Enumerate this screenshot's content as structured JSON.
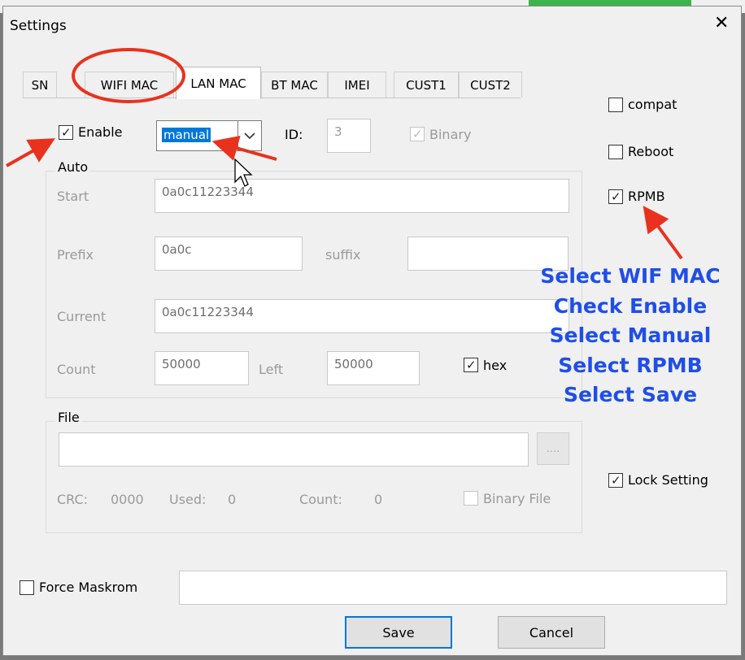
{
  "window": {
    "title": "Settings",
    "close_glyph": "✕"
  },
  "tabs": [
    {
      "label": "SN",
      "active": false
    },
    {
      "label": "WIFI MAC",
      "active": false
    },
    {
      "label": "LAN MAC",
      "active": true
    },
    {
      "label": "BT MAC",
      "active": false
    },
    {
      "label": "IMEI",
      "active": false
    },
    {
      "label": "CUST1",
      "active": false
    },
    {
      "label": "CUST2",
      "active": false
    }
  ],
  "enable": {
    "label": "Enable",
    "checked": true
  },
  "mode_combo": {
    "value": "manual"
  },
  "id": {
    "label": "ID:",
    "value": "3"
  },
  "binary": {
    "label": "Binary",
    "checked": true,
    "disabled": true
  },
  "auto": {
    "title": "Auto",
    "start_label": "Start",
    "start_value": "0a0c11223344",
    "prefix_label": "Prefix",
    "prefix_value": "0a0c",
    "suffix_label": "suffix",
    "suffix_value": "",
    "current_label": "Current",
    "current_value": "0a0c11223344",
    "count_label": "Count",
    "count_value": "50000",
    "left_label": "Left",
    "left_value": "50000",
    "hex_label": "hex",
    "hex_checked": true
  },
  "file": {
    "title": "File",
    "path_value": "",
    "browse_label": "....",
    "crc_label": "CRC:",
    "crc_value": "0000",
    "used_label": "Used:",
    "used_value": "0",
    "count_label": "Count:",
    "count_value": "0",
    "binary_file_label": "Binary File",
    "binary_file_checked": false
  },
  "right_options": {
    "compat": {
      "label": "compat",
      "checked": false
    },
    "reboot": {
      "label": "Reboot",
      "checked": false
    },
    "rpmb": {
      "label": "RPMB",
      "checked": true
    },
    "lock_setting": {
      "label": "Lock Setting",
      "checked": true
    }
  },
  "force_maskrom": {
    "label": "Force Maskrom",
    "checked": false,
    "field_value": ""
  },
  "buttons": {
    "save": "Save",
    "cancel": "Cancel"
  },
  "annotation": {
    "lines": [
      "Select WIF MAC",
      "Check Enable",
      "Select Manual",
      "Select RPMB",
      "Select Save"
    ],
    "text_color": "#1f4ee8",
    "arrow_color": "#e8321e"
  },
  "icons": {
    "check": "✓",
    "dropdown": "chevron-down-icon",
    "cursor": "mouse-pointer-icon"
  }
}
